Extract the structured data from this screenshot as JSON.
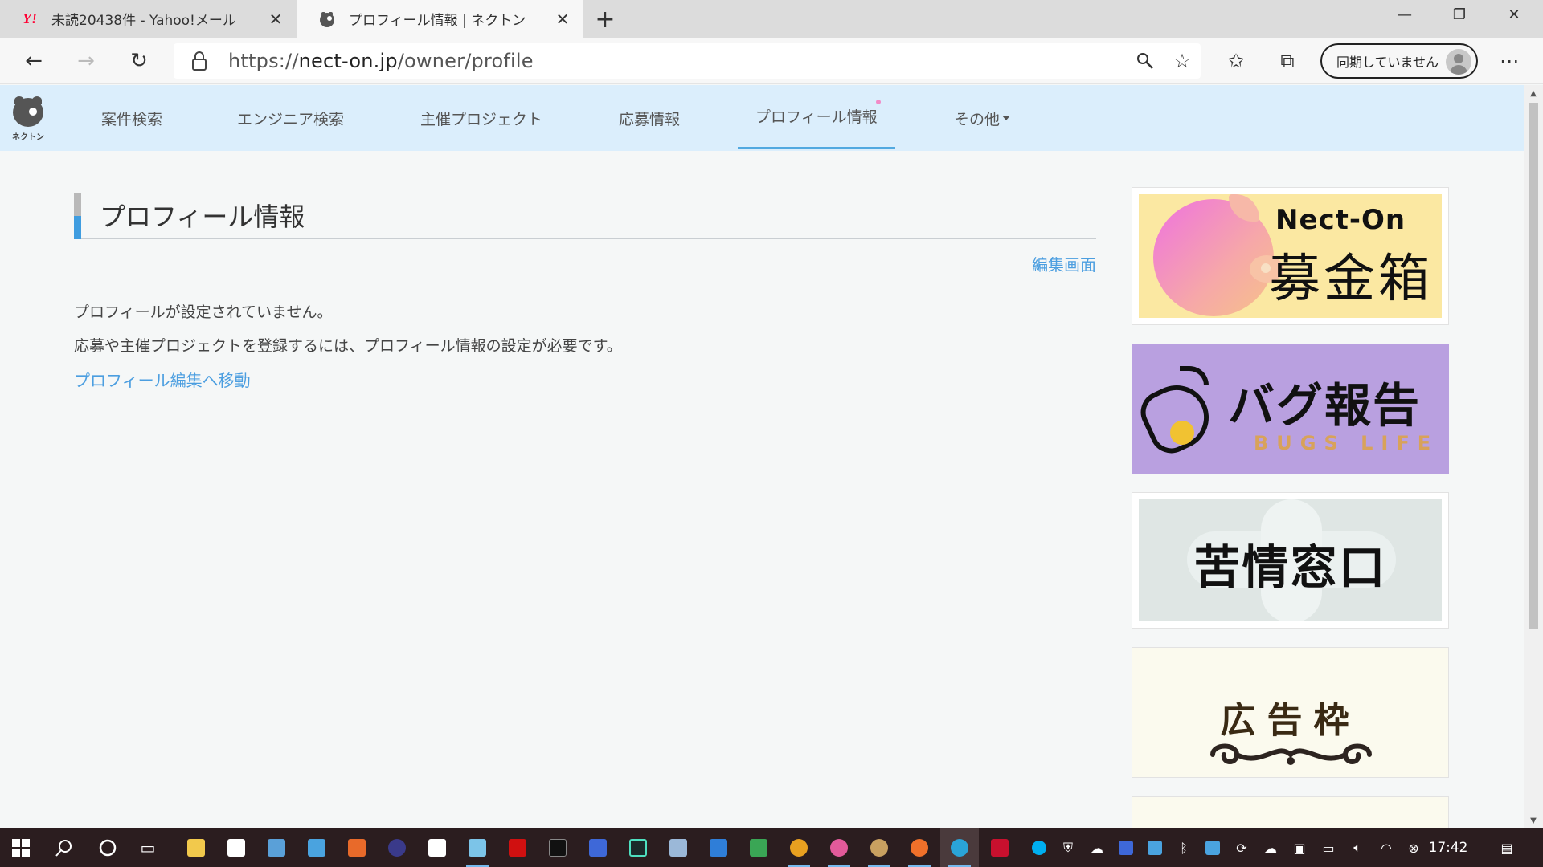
{
  "browser": {
    "tabs": [
      {
        "title": "未読20438件 - Yahoo!メール",
        "favicon": "yahoo-logo",
        "active": false
      },
      {
        "title": "プロフィール情報 | ネクトン",
        "favicon": "nectone-logo",
        "active": true
      }
    ],
    "url_prefix": "https://",
    "url_host": "nect-on.jp",
    "url_path": "/owner/profile",
    "sync_label": "同期していません",
    "yahoo_mark": "Y!"
  },
  "site": {
    "logo_label": "ネクトン",
    "nav": [
      {
        "label": "案件検索"
      },
      {
        "label": "エンジニア検索"
      },
      {
        "label": "主催プロジェクト"
      },
      {
        "label": "応募情報"
      },
      {
        "label": "プロフィール情報",
        "active": true
      },
      {
        "label": "その他"
      }
    ]
  },
  "main": {
    "heading": "プロフィール情報",
    "edit_link": "編集画面",
    "message1": "プロフィールが設定されていません。",
    "message2": "応募や主催プロジェクトを登録するには、プロフィール情報の設定が必要です。",
    "profile_link": "プロフィール編集へ移動"
  },
  "banners": {
    "fund": {
      "title_en": "Nect-On",
      "title_ja": "募金箱"
    },
    "bug": {
      "title": "バグ報告",
      "subtitle": "BUGS LIFE"
    },
    "complaint": {
      "title": "苦情窓口"
    },
    "ad": {
      "title": "広告枠"
    }
  },
  "taskbar": {
    "clock": "17:42"
  },
  "colors": {
    "accent_link": "#4b9ee0",
    "nav_bg": "#dbeefc",
    "active_underline": "#52a9e0",
    "taskbar_bg": "#2b1d1f"
  }
}
